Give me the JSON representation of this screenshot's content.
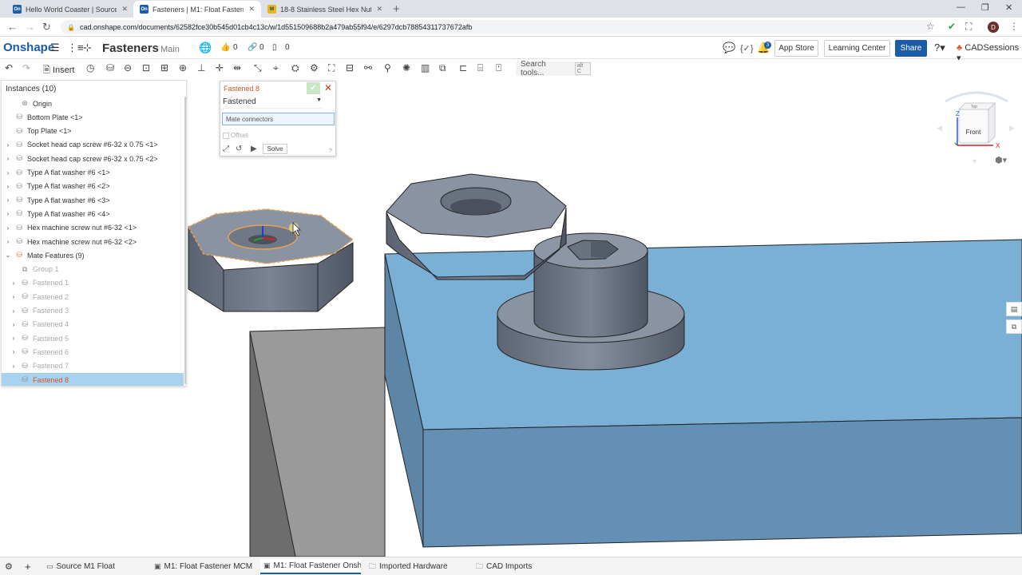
{
  "browser": {
    "tabs": [
      {
        "label": "Hello World Coaster | Source M1",
        "favicon": "On"
      },
      {
        "label": "Fasteners | M1: Float Fastener Or",
        "favicon": "On"
      },
      {
        "label": "18-8 Stainless Steel Hex Nut, 6-3",
        "favicon": "M"
      }
    ],
    "url": "cad.onshape.com/documents/62582fce30b545d01cb4c13c/w/1d551509688b2a479ab55f94/e/6297dcb78854311737672afb",
    "profile_initial": "D"
  },
  "header": {
    "logo": "Onshape",
    "document_title": "Fasteners",
    "branch": "Main",
    "likes": "0",
    "links": "0",
    "copies": "0",
    "notification_count": "3",
    "app_store": "App Store",
    "learning_center": "Learning Center",
    "share": "Share",
    "user": "CADSessions"
  },
  "toolbar": {
    "insert": "Insert",
    "search_placeholder": "Search tools...",
    "search_shortcut": "alt C"
  },
  "instances": {
    "header": "Instances (10)",
    "rows": [
      {
        "label": "Origin",
        "icon": "origin-icon",
        "caret": "",
        "style": ""
      },
      {
        "label": "Bottom Plate <1>",
        "icon": "part-icon",
        "caret": "",
        "style": ""
      },
      {
        "label": "Top Plate <1>",
        "icon": "part-icon",
        "caret": "",
        "style": ""
      },
      {
        "label": "Socket head cap screw #6-32 x 0.75 <1>",
        "icon": "part-icon",
        "caret": "›",
        "style": ""
      },
      {
        "label": "Socket head cap screw #6-32 x 0.75 <2>",
        "icon": "part-icon",
        "caret": "›",
        "style": ""
      },
      {
        "label": "Type A flat washer #6 <1>",
        "icon": "part-icon",
        "caret": "›",
        "style": ""
      },
      {
        "label": "Type A flat washer #6 <2>",
        "icon": "part-icon",
        "caret": "›",
        "style": ""
      },
      {
        "label": "Type A flat washer #6 <3>",
        "icon": "part-icon",
        "caret": "›",
        "style": ""
      },
      {
        "label": "Type A flat washer #6 <4>",
        "icon": "part-icon",
        "caret": "›",
        "style": ""
      },
      {
        "label": "Hex machine screw nut #6-32 <1>",
        "icon": "part-icon",
        "caret": "›",
        "style": ""
      },
      {
        "label": "Hex machine screw nut #6-32 <2>",
        "icon": "part-icon",
        "caret": "›",
        "style": ""
      },
      {
        "label": "Mate Features (9)",
        "icon": "mate-icon",
        "caret": "⌄",
        "style": "mate"
      },
      {
        "label": "Group 1",
        "icon": "group-icon",
        "caret": "",
        "style": "grey"
      },
      {
        "label": "Fastened 1",
        "icon": "mate-icon",
        "caret": "›",
        "style": "grey"
      },
      {
        "label": "Fastened 2",
        "icon": "mate-icon",
        "caret": "›",
        "style": "grey"
      },
      {
        "label": "Fastened 3",
        "icon": "mate-icon",
        "caret": "›",
        "style": "grey"
      },
      {
        "label": "Fastened 4",
        "icon": "mate-icon",
        "caret": "›",
        "style": "grey"
      },
      {
        "label": "Fastened 5",
        "icon": "mate-icon",
        "caret": "›",
        "style": "grey"
      },
      {
        "label": "Fastened 6",
        "icon": "mate-icon",
        "caret": "›",
        "style": "grey"
      },
      {
        "label": "Fastened 7",
        "icon": "mate-icon",
        "caret": "›",
        "style": "grey"
      },
      {
        "label": "Fastened 8",
        "icon": "mate-icon",
        "caret": "",
        "style": "sel"
      }
    ]
  },
  "mate_dialog": {
    "title": "Fastened 8",
    "type": "Fastened",
    "field": "Mate connectors",
    "offset": "Offset",
    "solve": "Solve"
  },
  "viewcube": {
    "face": "Front",
    "top": "Top",
    "axis_x": "X",
    "axis_z": "Z"
  },
  "bottom_tabs": [
    {
      "label": "Source M1 Float",
      "icon": "part-studio-icon"
    },
    {
      "label": "M1: Float Fastener MCM",
      "icon": "assembly-icon"
    },
    {
      "label": "M1: Float Fastener Onsh...",
      "icon": "assembly-icon"
    },
    {
      "label": "Imported Hardware",
      "icon": "folder-icon"
    },
    {
      "label": "CAD Imports",
      "icon": "folder-icon"
    }
  ],
  "colors": {
    "brand": "#1c5ba6",
    "plate": "#7aafd6",
    "metal": "#7d8796",
    "selection": "#e8a155"
  }
}
